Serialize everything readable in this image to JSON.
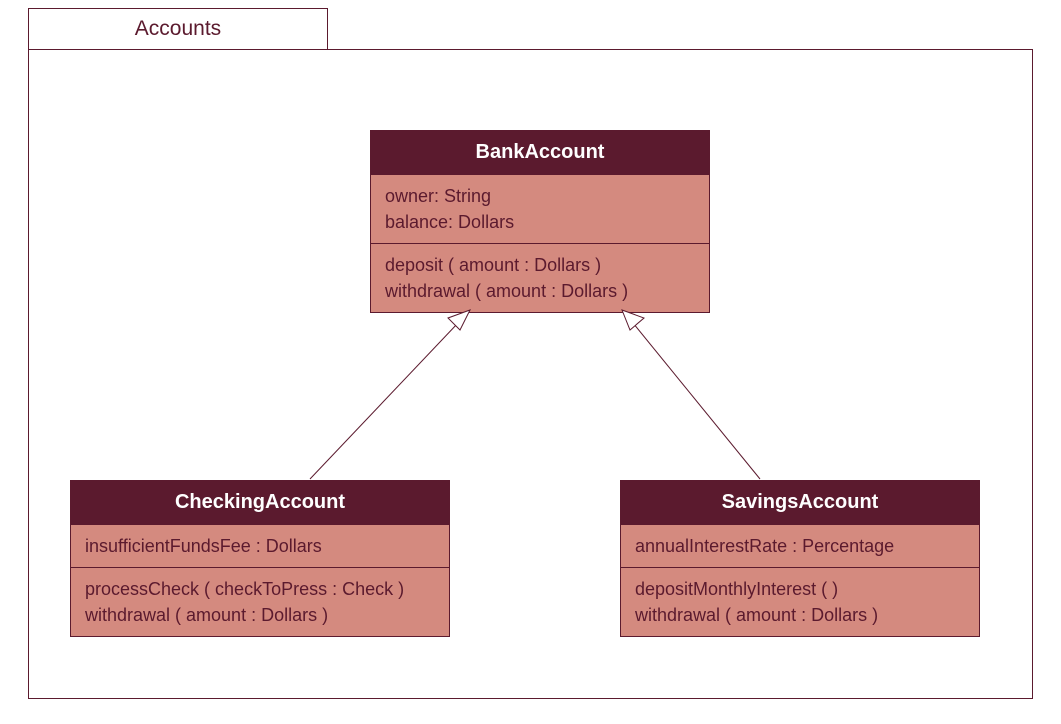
{
  "package": {
    "name": "Accounts"
  },
  "classes": {
    "bankAccount": {
      "name": "BankAccount",
      "attributes": [
        "owner: String",
        "balance: Dollars"
      ],
      "methods": [
        "deposit ( amount : Dollars )",
        "withdrawal ( amount : Dollars )"
      ]
    },
    "checkingAccount": {
      "name": "CheckingAccount",
      "attributes": [
        "insufficientFundsFee : Dollars"
      ],
      "methods": [
        "processCheck ( checkToPress : Check )",
        "withdrawal ( amount : Dollars )"
      ]
    },
    "savingsAccount": {
      "name": "SavingsAccount",
      "attributes": [
        "annualInterestRate : Percentage"
      ],
      "methods": [
        "depositMonthlyInterest (  )",
        "withdrawal ( amount : Dollars )"
      ]
    }
  },
  "relationships": [
    {
      "type": "generalization",
      "child": "CheckingAccount",
      "parent": "BankAccount"
    },
    {
      "type": "generalization",
      "child": "SavingsAccount",
      "parent": "BankAccount"
    }
  ]
}
